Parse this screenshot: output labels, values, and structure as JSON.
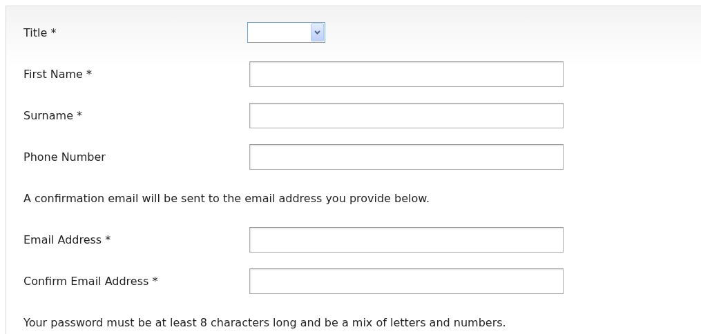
{
  "form": {
    "items": [
      {
        "kind": "select",
        "label": "Title *"
      },
      {
        "kind": "text",
        "label": "First Name *"
      },
      {
        "kind": "text",
        "label": "Surname *"
      },
      {
        "kind": "text",
        "label": "Phone Number"
      },
      {
        "kind": "note",
        "text": "A confirmation email will be sent to the email address you provide below."
      },
      {
        "kind": "text",
        "label": "Email Address *"
      },
      {
        "kind": "text",
        "label": "Confirm Email Address *"
      },
      {
        "kind": "note",
        "text": "Your password must be at least 8 characters long and be a mix of letters and numbers."
      }
    ]
  }
}
